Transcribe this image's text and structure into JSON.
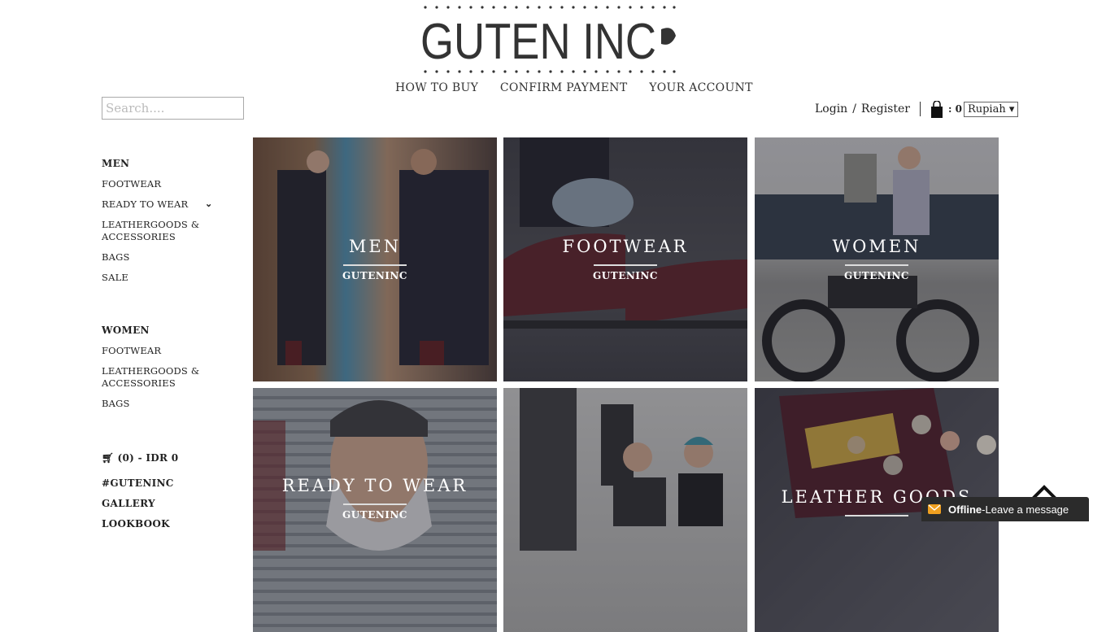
{
  "logo": {
    "text": "GUTEN INC"
  },
  "nav": [
    "HOW TO BUY",
    "CONFIRM PAYMENT",
    "YOUR ACCOUNT"
  ],
  "search": {
    "placeholder": "Search...."
  },
  "account": {
    "login": "Login",
    "slash": "/",
    "register": "Register",
    "cart_count": ": 0",
    "currency": "Rupiah"
  },
  "sidebar": {
    "men_head": "MEN",
    "men_items": [
      "FOOTWEAR",
      "READY TO WEAR",
      "LEATHERGOODS &",
      "ACCESSORIES",
      "BAGS",
      "SALE"
    ],
    "women_head": "WOMEN",
    "women_items": [
      "FOOTWEAR",
      "LEATHERGOODS &",
      "ACCESSORIES",
      "BAGS"
    ],
    "cart": "(0) - IDR 0",
    "hashtag": "#GUTENINC",
    "gallery": "GALLERY",
    "lookbook": "LOOKBOOK"
  },
  "tiles": [
    {
      "title": "MEN",
      "sub": "GUTENINC"
    },
    {
      "title": "FOOTWEAR",
      "sub": "GUTENINC"
    },
    {
      "title": "WOMEN",
      "sub": "GUTENINC"
    },
    {
      "title": "READY TO WEAR",
      "sub": "GUTENINC"
    },
    {
      "title": "",
      "sub": ""
    },
    {
      "title": "LEATHER GOODS",
      "sub": ""
    }
  ],
  "chat": {
    "status": "Offline",
    "dash": " - ",
    "message": "Leave a message"
  },
  "colors": {
    "accent_chat": "#f0a020",
    "chat_bg": "#2b2b2b"
  }
}
